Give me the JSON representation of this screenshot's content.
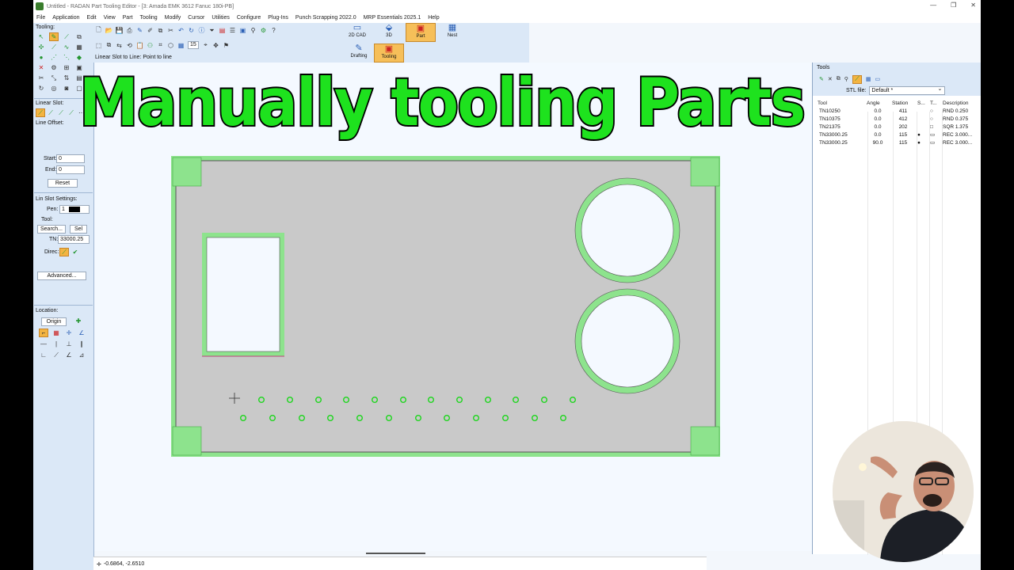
{
  "window": {
    "title": "Untitled - RADAN Part Tooling Editor - [3: Amada EMK 3612 Fanuc 180i-PB]",
    "controls": [
      "—",
      "❐",
      "✕"
    ]
  },
  "menu": [
    "File",
    "Application",
    "Edit",
    "View",
    "Part",
    "Tooling",
    "Modify",
    "Cursor",
    "Utilities",
    "Configure",
    "Plug-Ins",
    "Punch Scrapping 2022.0",
    "MRP Essentials 2025.1",
    "Help"
  ],
  "ribbon": {
    "zoom_value": "15",
    "modes": [
      "2D CAD",
      "3D",
      "Part",
      "Nest"
    ],
    "submodes": [
      "Drafting",
      "Tooling"
    ],
    "active_mode": "Part",
    "active_submode": "Tooling"
  },
  "hint": "Linear Slot to Line: Point to line",
  "left_panel": {
    "tooling_label": "Tooling:",
    "linear_slot_label": "Linear Slot:",
    "line_offset_label": "Line Offset:",
    "start_label": "Start:",
    "start_value": "0",
    "end_label": "End:",
    "end_value": "0",
    "reset_label": "Reset",
    "lin_slot_settings_label": "Lin Slot Settings:",
    "pen_label": "Pen:",
    "pen_value": "1",
    "tool_label": "Tool:",
    "search_label": "Search...",
    "sel_label": "Sel",
    "tn_label": "TN:",
    "tn_value": "33000.25",
    "direc_label": "Direc:",
    "advanced_label": "Advanced...",
    "location_label": "Location:",
    "origin_label": "Origin"
  },
  "tools_panel": {
    "title": "Tools",
    "stl_label": "STL file:",
    "stl_value": "Default *",
    "columns": [
      "Tool",
      "Angle",
      "Station",
      "S...",
      "T...",
      "Description"
    ],
    "rows": [
      {
        "tool": "TN10250",
        "angle": "0.0",
        "station": "411",
        "desc": "RND 0.250"
      },
      {
        "tool": "TN10375",
        "angle": "0.0",
        "station": "412",
        "desc": "RND 0.375"
      },
      {
        "tool": "TN21375",
        "angle": "0.0",
        "station": "202",
        "desc": "SQR 1.375"
      },
      {
        "tool": "TN33000.25",
        "angle": "0.0",
        "station": "115",
        "desc": "REC 3.000..."
      },
      {
        "tool": "TN33000.25",
        "angle": "90.0",
        "station": "115",
        "desc": "REC 3.000..."
      }
    ]
  },
  "status": {
    "coords": "-0.6864, -2.6510"
  },
  "overlay_title": "Manually tooling Parts",
  "colors": {
    "accent_green": "#1ee21e",
    "tool_green": "#8de38d",
    "part_gray": "#c9c9c9",
    "ribbon_blue": "#dbe8f7",
    "active_orange": "#f6bf59"
  },
  "icons": [
    "app-icon",
    "pen-icon",
    "slot-icon",
    "cross-icon",
    "gear-icon",
    "origin-icon",
    "grid-icon"
  ]
}
